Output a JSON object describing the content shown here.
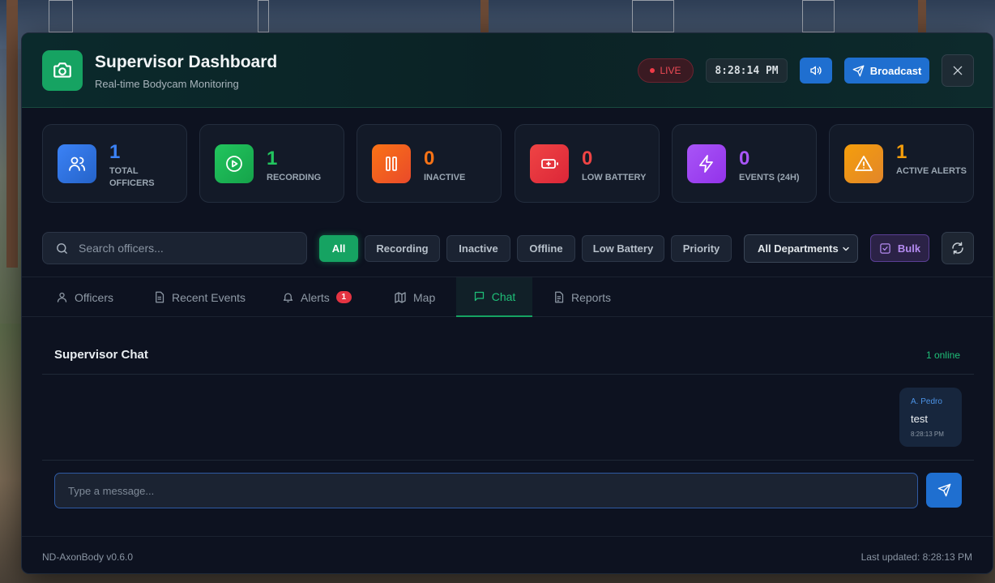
{
  "header": {
    "title": "Supervisor Dashboard",
    "subtitle": "Real-time Bodycam Monitoring",
    "live_label": "LIVE",
    "clock": "8:28:14 PM",
    "broadcast_label": "Broadcast"
  },
  "stats": [
    {
      "value": "1",
      "label": "Total Officers",
      "color": "#3b82f6",
      "icon": "users-icon"
    },
    {
      "value": "1",
      "label": "Recording",
      "color": "#22c55e",
      "icon": "play-icon"
    },
    {
      "value": "0",
      "label": "Inactive",
      "color": "#f97316",
      "icon": "pause-icon"
    },
    {
      "value": "0",
      "label": "Low Battery",
      "color": "#ef4444",
      "icon": "battery-icon"
    },
    {
      "value": "0",
      "label": "Events (24h)",
      "color": "#a855f7",
      "icon": "bolt-icon"
    },
    {
      "value": "1",
      "label": "Active Alerts",
      "color": "#f59e0b",
      "icon": "warning-icon"
    }
  ],
  "search": {
    "placeholder": "Search officers..."
  },
  "filters": [
    "All",
    "Recording",
    "Inactive",
    "Offline",
    "Low Battery",
    "Priority"
  ],
  "active_filter": "All",
  "department_select": "All Departments",
  "bulk_label": "Bulk",
  "tabs": [
    {
      "label": "Officers",
      "icon": "user-icon"
    },
    {
      "label": "Recent Events",
      "icon": "document-icon"
    },
    {
      "label": "Alerts",
      "icon": "bell-icon",
      "badge": "1"
    },
    {
      "label": "Map",
      "icon": "map-icon"
    },
    {
      "label": "Chat",
      "icon": "chat-icon"
    },
    {
      "label": "Reports",
      "icon": "report-icon"
    }
  ],
  "active_tab": "Chat",
  "chat": {
    "title": "Supervisor Chat",
    "online": "1 online",
    "messages": [
      {
        "sender": "A. Pedro",
        "text": "test",
        "time": "8:28:13 PM"
      }
    ],
    "input_placeholder": "Type a message..."
  },
  "footer": {
    "version": "ND-AxonBody v0.6.0",
    "last_updated": "Last updated: 8:28:13 PM"
  }
}
